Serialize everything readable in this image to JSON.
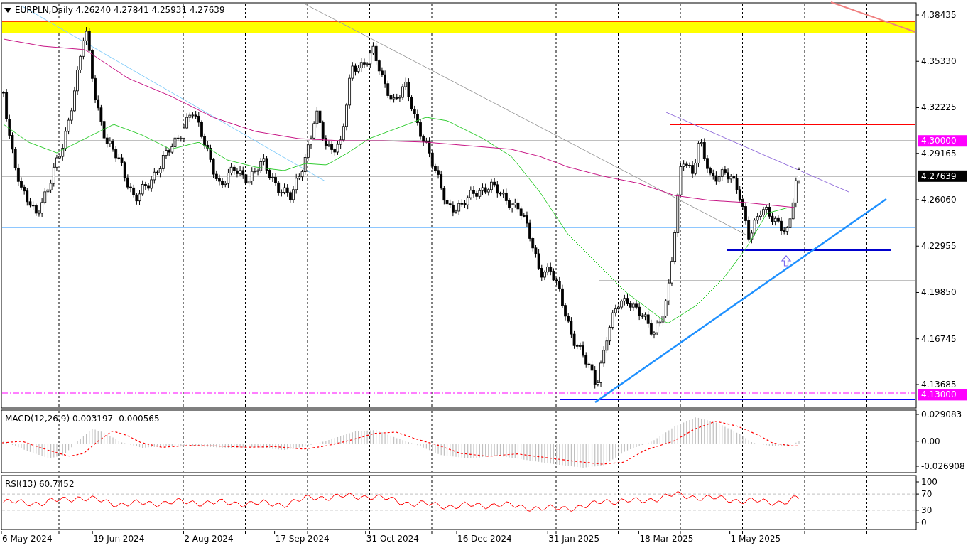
{
  "header": {
    "title": "EURPLN,Daily",
    "values": [
      "4.26240",
      "4.27841",
      "4.25931",
      "4.27639"
    ]
  },
  "price_axis": {
    "ticks": [
      "4.38435",
      "4.35330",
      "4.32225",
      "4.29165",
      "4.26060",
      "4.22955",
      "4.19850",
      "4.16745",
      "4.13685"
    ]
  },
  "price_tags": [
    {
      "label": "4.30000",
      "color": "#ff00ff"
    },
    {
      "label": "4.27639",
      "color": "#000000"
    },
    {
      "label": "4.13000",
      "color": "#ff00ff"
    }
  ],
  "macd": {
    "label": "MACD(12,26,9) 0.003197 -0.000565",
    "ticks": [
      "0.029083",
      "0.00",
      "-0.026908"
    ]
  },
  "rsi": {
    "label": "RSI(13) 60.7452",
    "ticks": [
      "100",
      "70",
      "30",
      "0"
    ]
  },
  "date_axis": {
    "labels": [
      "6 May 2024",
      "19 Jun 2024",
      "2 Aug 2024",
      "17 Sep 2024",
      "31 Oct 2024",
      "16 Dec 2024",
      "31 Jan 2025",
      "18 Mar 2025",
      "1 May 2025"
    ]
  }
}
